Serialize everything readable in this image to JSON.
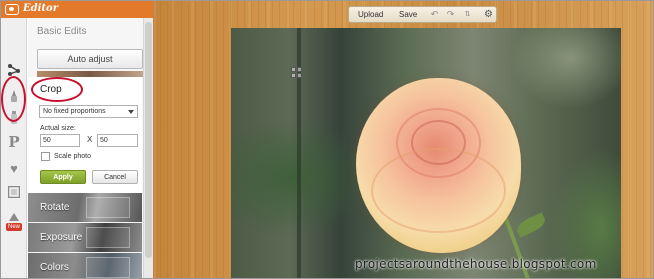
{
  "app": {
    "title": "Editor"
  },
  "toolbar": {
    "upload_label": "Upload",
    "save_label": "Save"
  },
  "panel": {
    "title": "Basic Edits",
    "auto_adjust_label": "Auto adjust",
    "crop": {
      "label": "Crop",
      "proportion_selected": "No fixed proportions",
      "actual_size_label": "Actual size:",
      "width_value": "50",
      "x_label": "X",
      "height_value": "50",
      "scale_label": "Scale photo",
      "scale_checked": false,
      "apply_label": "Apply",
      "cancel_label": "Cancel"
    },
    "tools": [
      {
        "label": "Rotate"
      },
      {
        "label": "Exposure"
      },
      {
        "label": "Colors"
      }
    ]
  },
  "rail": {
    "icons": [
      "filters-icon",
      "brush-icon",
      "tube-icon",
      "text-p-icon",
      "hearts-icon",
      "frame-icon",
      "new-icon"
    ],
    "new_badge": "New"
  },
  "watermark": "projectsaroundthehouse.blogspot.com",
  "colors": {
    "header": "#e3792a",
    "apply": "#8aab33",
    "annotation_ring": "#c8102e"
  }
}
